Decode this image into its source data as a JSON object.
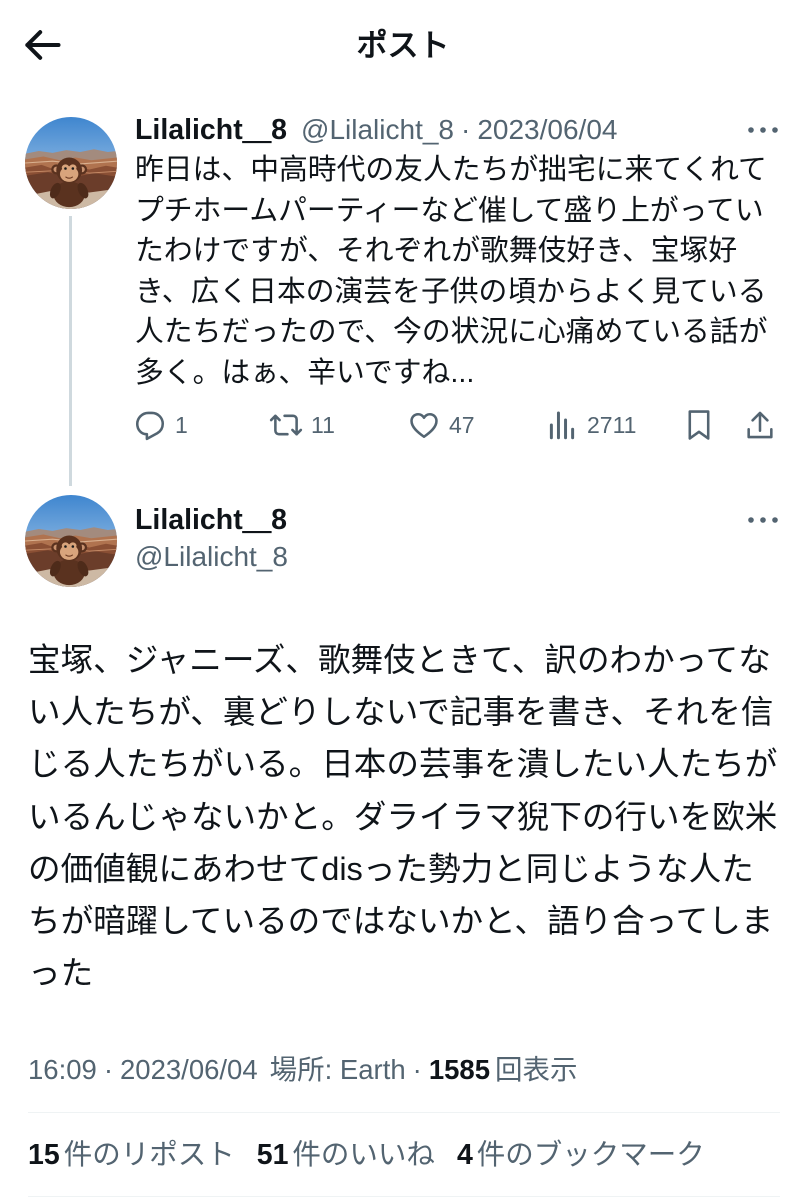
{
  "header": {
    "title": "ポスト"
  },
  "parent": {
    "name": "Lilalicht＿8",
    "handle": "@Lilalicht_8",
    "separator": "·",
    "date": "2023/06/04",
    "text_lines": [
      "昨日は、中高時代の友人たちが拙宅に来てくれて",
      "プチホームパーティーなど催して盛り上がってい",
      "たわけですが、それぞれが歌舞伎好き、宝塚好",
      "き、広く日本の演芸を子供の頃からよく見ている",
      "人たちだったので、今の状況に心痛めている話が",
      "多く。はぁ、辛いですね..."
    ],
    "actions": {
      "reply_count": "1",
      "repost_count": "11",
      "like_count": "47",
      "view_count": "2711"
    }
  },
  "main": {
    "name": "Lilalicht＿8",
    "handle": "@Lilalicht_8",
    "text_lines": [
      "宝塚、ジャニーズ、歌舞伎ときて、訳のわかってな",
      "い人たちが、裏どりしないで記事を書き、それを信",
      "じる人たちがいる。日本の芸事を潰したい人たちが",
      "いるんじゃないかと。ダライラマ猊下の行いを欧米",
      "の価値観にあわせてdisった勢力と同じような人た",
      "ちが暗躍しているのではないかと、語り合ってしま",
      "った"
    ],
    "meta": {
      "time": "16:09",
      "separator": "·",
      "date": "2023/06/04",
      "location": "場所: Earth",
      "views_count": "1585",
      "views_label": "回表示"
    },
    "stats": [
      {
        "count": "15",
        "label": "件のリポスト"
      },
      {
        "count": "51",
        "label": "件のいいね"
      },
      {
        "count": "4",
        "label": "件のブックマーク"
      }
    ]
  },
  "icons": {
    "back": "arrow-left-icon",
    "more": "more-horizontal-icon",
    "reply": "reply-icon",
    "repost": "repost-icon",
    "like": "heart-icon",
    "views": "views-icon",
    "bookmark": "bookmark-icon",
    "share": "share-icon",
    "avatar": "monkey-at-canyon-photo"
  },
  "colors": {
    "primary_text": "#0f1419",
    "secondary_text": "#536471",
    "thread_line": "#cfd9de",
    "divider": "#eff3f4",
    "background": "#ffffff"
  }
}
